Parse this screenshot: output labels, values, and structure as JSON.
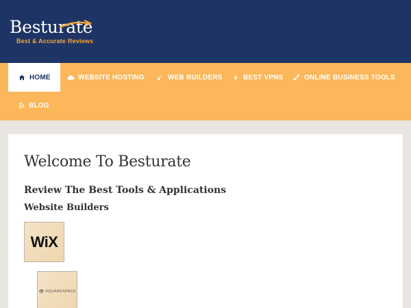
{
  "brand": {
    "name": "Besturate",
    "tagline": "Best & Accurate Reviews"
  },
  "nav": {
    "items": [
      {
        "label": "HOME",
        "icon": "home-icon"
      },
      {
        "label": "WEBSITE HOSTING",
        "icon": "cloud-icon"
      },
      {
        "label": "WEB BUILDERS",
        "icon": "brush-icon"
      },
      {
        "label": "BEST VPNS",
        "icon": "bolt-icon"
      },
      {
        "label": "ONLINE BUSINESS TOOLS",
        "icon": "expand-icon"
      },
      {
        "label": "BLOG",
        "icon": "rss-icon"
      }
    ]
  },
  "main": {
    "title": "Welcome To Besturate",
    "subtitle": "Review The Best Tools & Applications",
    "section": "Website Builders",
    "products": [
      {
        "label": "WiX"
      },
      {
        "label": "SQUARESPACE"
      }
    ]
  },
  "colors": {
    "header": "#1e3464",
    "nav": "#fbb75a",
    "accent": "#f5a53a",
    "background": "#e9e6e1"
  }
}
